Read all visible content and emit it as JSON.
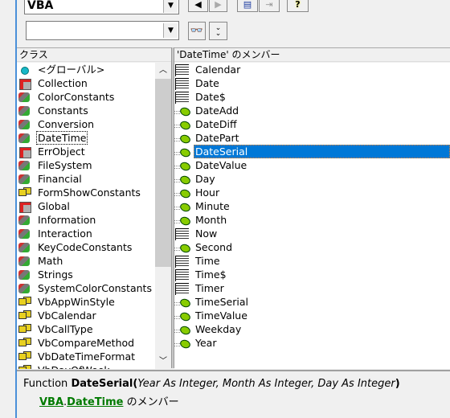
{
  "toolbar": {
    "library": "VBA",
    "search": "",
    "prev_icon": "back-arrow-icon",
    "next_icon": "forward-arrow-icon",
    "copy_icon": "copy-icon",
    "view_def_icon": "view-definition-icon",
    "help_icon": "help-icon",
    "search_icon": "binoculars-icon",
    "toggle_icon": "chevron-double-down-icon"
  },
  "classes": {
    "header": "クラス",
    "items": [
      {
        "label": "<グローバル>",
        "type": "global"
      },
      {
        "label": "Collection",
        "type": "class"
      },
      {
        "label": "ColorConstants",
        "type": "module"
      },
      {
        "label": "Constants",
        "type": "module"
      },
      {
        "label": "Conversion",
        "type": "module"
      },
      {
        "label": "DateTime",
        "type": "module",
        "focused": true
      },
      {
        "label": "ErrObject",
        "type": "class"
      },
      {
        "label": "FileSystem",
        "type": "module"
      },
      {
        "label": "Financial",
        "type": "module"
      },
      {
        "label": "FormShowConstants",
        "type": "enum"
      },
      {
        "label": "Global",
        "type": "class"
      },
      {
        "label": "Information",
        "type": "module"
      },
      {
        "label": "Interaction",
        "type": "module"
      },
      {
        "label": "KeyCodeConstants",
        "type": "module"
      },
      {
        "label": "Math",
        "type": "module"
      },
      {
        "label": "Strings",
        "type": "module"
      },
      {
        "label": "SystemColorConstants",
        "type": "module"
      },
      {
        "label": "VbAppWinStyle",
        "type": "enum"
      },
      {
        "label": "VbCalendar",
        "type": "enum"
      },
      {
        "label": "VbCallType",
        "type": "enum"
      },
      {
        "label": "VbCompareMethod",
        "type": "enum"
      },
      {
        "label": "VbDateTimeFormat",
        "type": "enum"
      },
      {
        "label": "VbDayOfWeek",
        "type": "enum"
      }
    ]
  },
  "members": {
    "header": "'DateTime' のメンバー",
    "items": [
      {
        "label": "Calendar",
        "type": "prop"
      },
      {
        "label": "Date",
        "type": "prop"
      },
      {
        "label": "Date$",
        "type": "prop"
      },
      {
        "label": "DateAdd",
        "type": "fn"
      },
      {
        "label": "DateDiff",
        "type": "fn"
      },
      {
        "label": "DatePart",
        "type": "fn"
      },
      {
        "label": "DateSerial",
        "type": "fn",
        "selected": true
      },
      {
        "label": "DateValue",
        "type": "fn"
      },
      {
        "label": "Day",
        "type": "fn"
      },
      {
        "label": "Hour",
        "type": "fn"
      },
      {
        "label": "Minute",
        "type": "fn"
      },
      {
        "label": "Month",
        "type": "fn"
      },
      {
        "label": "Now",
        "type": "prop"
      },
      {
        "label": "Second",
        "type": "fn"
      },
      {
        "label": "Time",
        "type": "prop"
      },
      {
        "label": "Time$",
        "type": "prop"
      },
      {
        "label": "Timer",
        "type": "prop"
      },
      {
        "label": "TimeSerial",
        "type": "fn"
      },
      {
        "label": "TimeValue",
        "type": "fn"
      },
      {
        "label": "Weekday",
        "type": "fn"
      },
      {
        "label": "Year",
        "type": "fn"
      }
    ]
  },
  "details": {
    "kind": "Function",
    "name": "DateSerial",
    "open": "(",
    "params": "Year As Integer, Month As Integer, Day As Integer",
    "close": ")",
    "library_link": "VBA",
    "dot": ".",
    "class_link": "DateTime",
    "suffix": " のメンバー"
  },
  "colors": {
    "selection": "#0078d7",
    "link": "#007a00"
  }
}
